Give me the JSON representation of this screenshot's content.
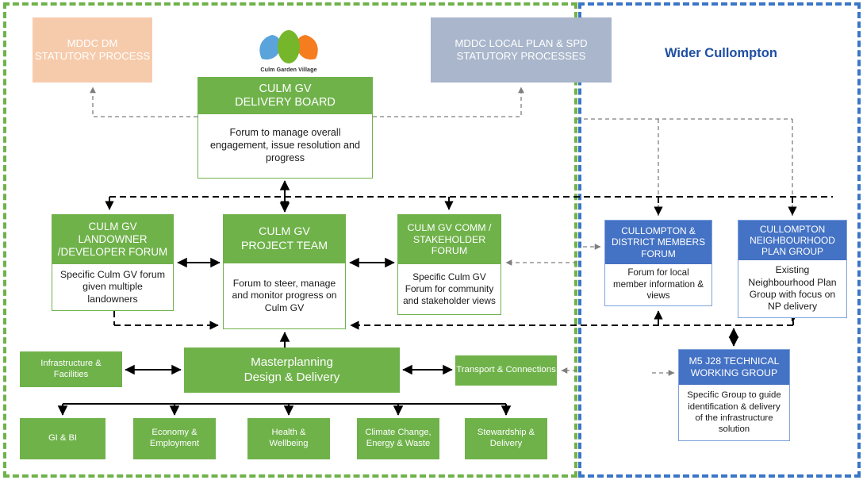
{
  "regions": {
    "left": {
      "name": "culm-garden-village-region",
      "border_color": "#6FB24A"
    },
    "right": {
      "name": "wider-cullompton-region",
      "title": "Wider Cullompton",
      "border_color": "#3A76C6",
      "title_color": "#1F4FA3"
    }
  },
  "logo": {
    "caption": "Culm Garden Village",
    "petal_blue": "#5BA3DB",
    "petal_green": "#76B62A",
    "petal_orange": "#F57C1F"
  },
  "statutory": {
    "mddc_dm": "MDDC DM\nSTATUTORY PROCESS",
    "mddc_dm_line1": "MDDC DM",
    "mddc_dm_line2": "STATUTORY PROCESS",
    "mddc_local_plan_line1": "MDDC LOCAL PLAN & SPD",
    "mddc_local_plan_line2": "STATUTORY PROCESSES",
    "peach_color": "#F6CBAC",
    "slate_color": "#A9B6CB"
  },
  "boards": {
    "delivery_board": {
      "title_line1": "CULM GV",
      "title_line2": "DELIVERY BOARD",
      "body": "Forum to manage overall engagement, issue resolution and progress"
    },
    "landowner_forum": {
      "title_line1": "CULM GV",
      "title_line2": "LANDOWNER",
      "title_line3": "/DEVELOPER FORUM",
      "body": "Specific Culm GV forum given multiple landowners"
    },
    "project_team": {
      "title_line1": "CULM GV",
      "title_line2": "PROJECT TEAM",
      "body": "Forum to steer, manage and monitor progress on Culm GV"
    },
    "comm_forum": {
      "title_line1": "CULM GV COMM /",
      "title_line2": "STAKEHOLDER",
      "title_line3": "FORUM",
      "body": "Specific Culm GV Forum for community and stakeholder views"
    },
    "members_forum": {
      "title_line1": "CULLOMPTON &",
      "title_line2": "DISTRICT MEMBERS",
      "title_line3": "FORUM",
      "body": "Forum for local member information & views"
    },
    "np_group": {
      "title_line1": "CULLOMPTON",
      "title_line2": "NEIGHBOURHOOD",
      "title_line3": "PLAN GROUP",
      "body": "Existing Neighbourhood Plan Group with focus on NP delivery"
    },
    "m5_group": {
      "title_line1": "M5 J28 TECHNICAL",
      "title_line2": "WORKING GROUP",
      "body": "Specific Group to guide identification & delivery of the infrastructure solution"
    }
  },
  "workstreams": {
    "infrastructure_line1": "Infrastructure &",
    "infrastructure_line2": "Facilities",
    "masterplanning_line1": "Masterplanning",
    "masterplanning_line2": "Design & Delivery",
    "transport": "Transport & Connections",
    "themes": [
      {
        "line1": "GI & BI",
        "line2": ""
      },
      {
        "line1": "Economy &",
        "line2": "Employment"
      },
      {
        "line1": "Health &",
        "line2": "Wellbeing"
      },
      {
        "line1": "Climate Change,",
        "line2": "Energy & Waste"
      },
      {
        "line1": "Stewardship &",
        "line2": "Delivery"
      }
    ]
  },
  "colors": {
    "green": "#6FB24A",
    "blue": "#4472C4",
    "peach": "#F6CBAC",
    "slate": "#A9B6CB",
    "arrow_black": "#000000",
    "arrow_gray": "#7F7F7F"
  }
}
